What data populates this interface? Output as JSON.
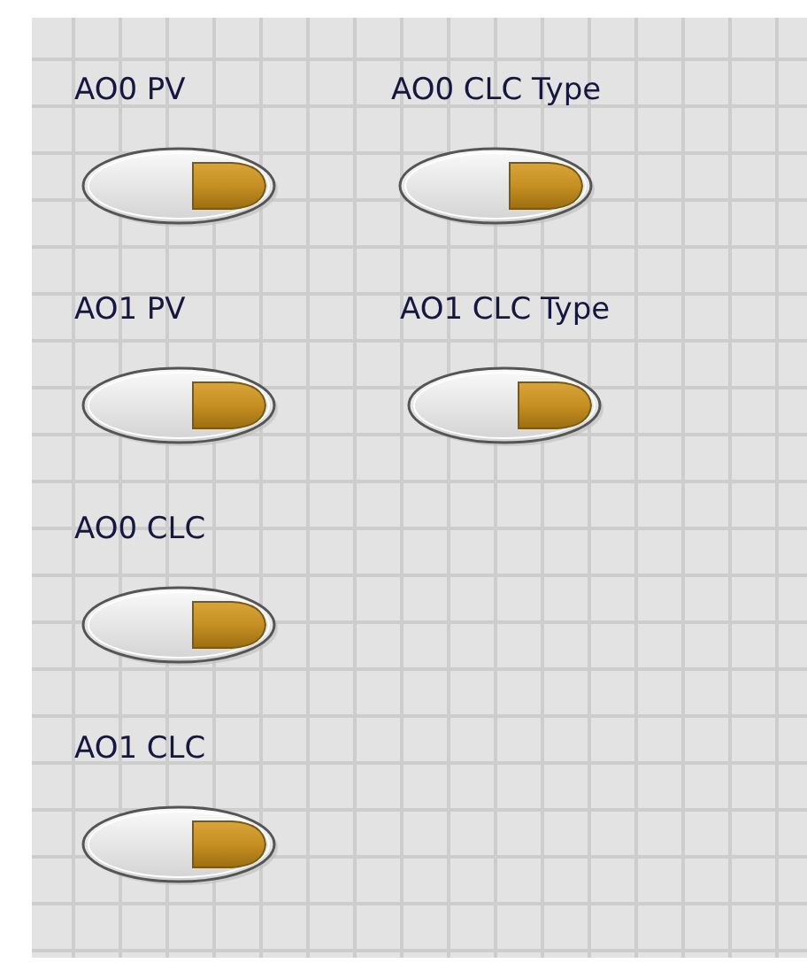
{
  "panel": {
    "columns": [
      {
        "controls": [
          {
            "label": "AO0 PV",
            "on": true
          },
          {
            "label": "AO1 PV",
            "on": true
          },
          {
            "label": "AO0 CLC",
            "on": true
          },
          {
            "label": "AO1 CLC",
            "on": true
          }
        ]
      },
      {
        "controls": [
          {
            "label": "AO0 CLC Type",
            "on": true
          },
          {
            "label": "AO1 CLC Type",
            "on": true
          }
        ]
      }
    ]
  }
}
